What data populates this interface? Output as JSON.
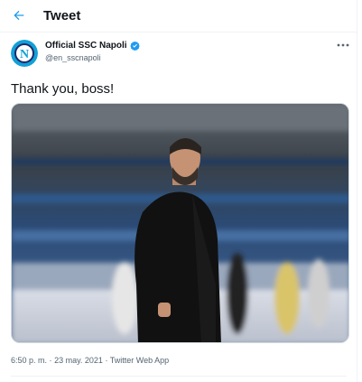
{
  "header": {
    "title": "Tweet",
    "back_icon": "arrow-left-icon"
  },
  "author": {
    "display_name": "Official SSC Napoli",
    "handle": "@en_sscnapoli",
    "verified_icon": "verified-badge-icon",
    "avatar_icon": "ssc-napoli-logo"
  },
  "tweet": {
    "text": "Thank you, boss!",
    "media_description_icon": "photo-coach-on-pitch",
    "time": "6:50 p. m.",
    "separator": "·",
    "date": "23 may. 2021",
    "source": "Twitter Web App"
  },
  "colors": {
    "accent": "#1d9bf0",
    "text": "#0f1419",
    "secondary": "#536471",
    "border": "#eff3f4"
  }
}
